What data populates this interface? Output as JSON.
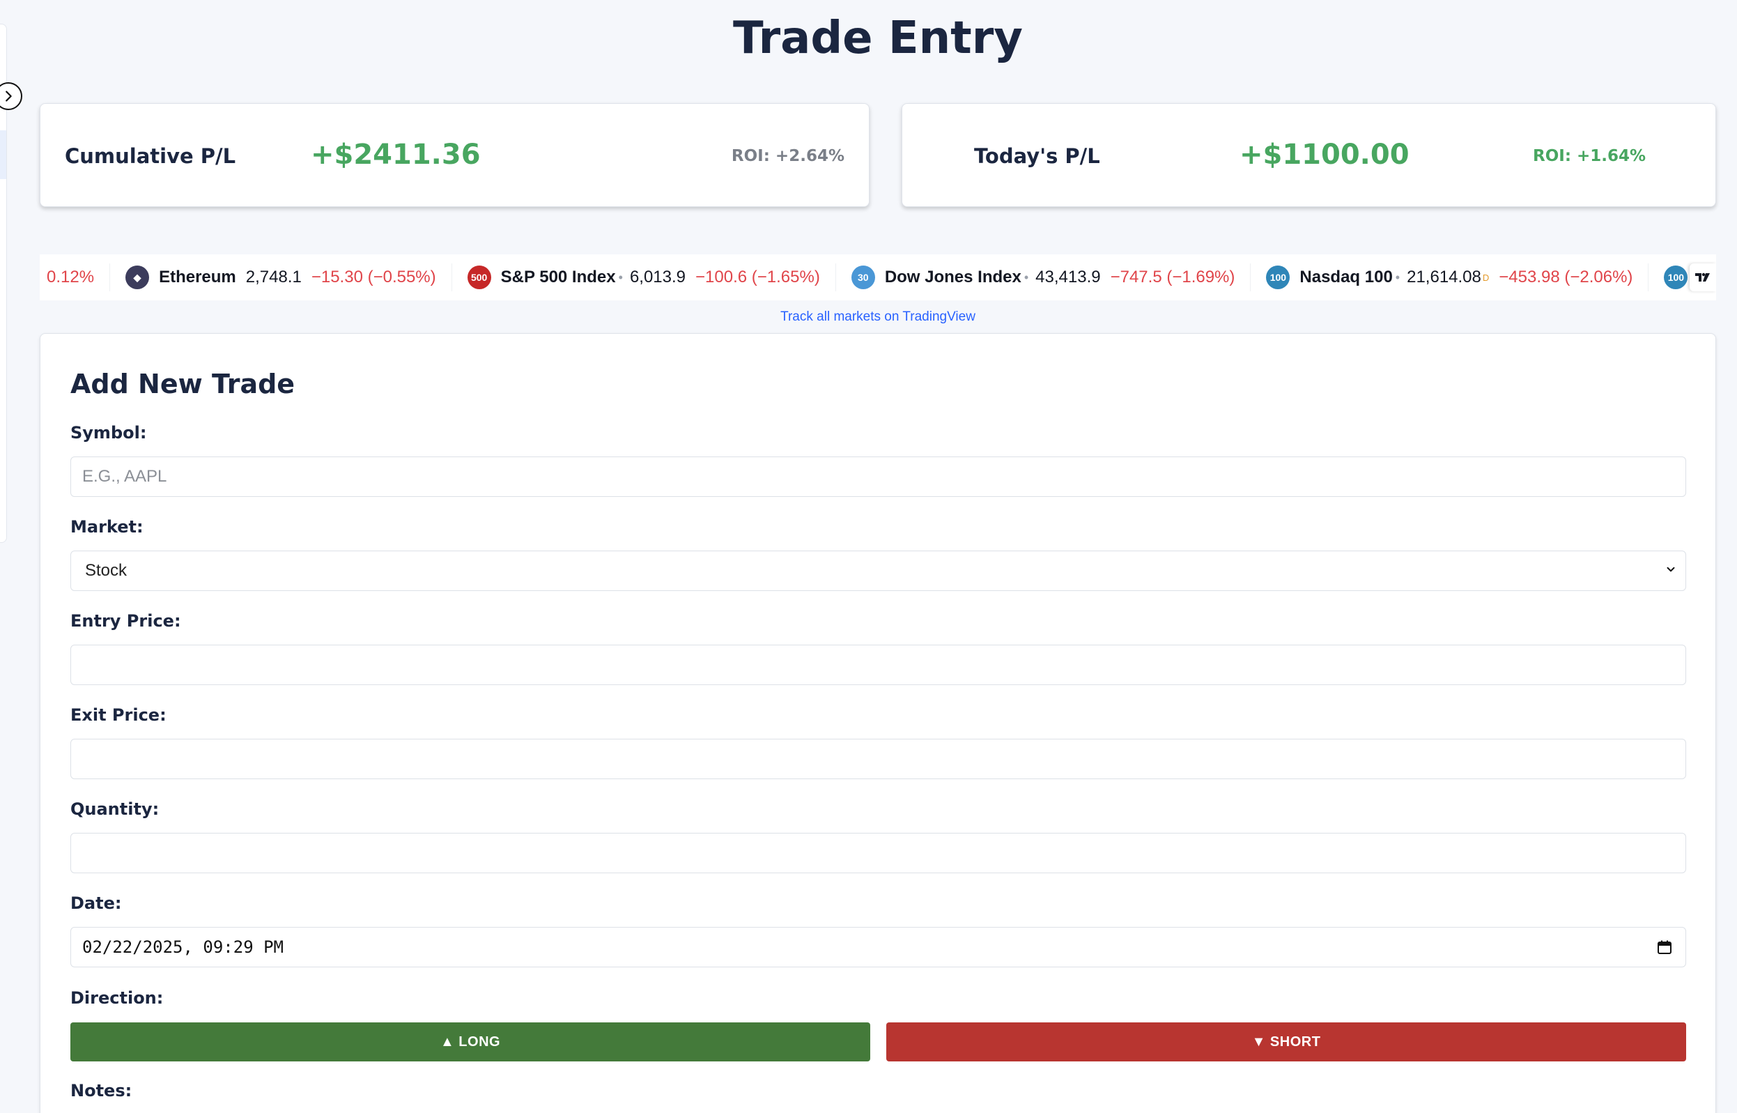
{
  "page": {
    "title": "Trade Entry"
  },
  "cards": {
    "cumulative": {
      "label": "Cumulative P/L",
      "value": "+$2411.36",
      "roi": "ROI: +2.64%"
    },
    "today": {
      "label": "Today's P/L",
      "value": "+$1100.00",
      "roi": "ROI: +1.64%"
    }
  },
  "ticker": {
    "items": [
      {
        "logo": "",
        "logo_color": "#ffffff",
        "name": "",
        "price": "",
        "sup": "",
        "change": "0.12%"
      },
      {
        "logo": "◆",
        "logo_color": "#3c3c5c",
        "name": "Ethereum",
        "price": "2,748.1",
        "sup": "",
        "change": "−15.30 (−0.55%)"
      },
      {
        "logo": "500",
        "logo_color": "#c62828",
        "name": "S&P 500 Index",
        "price": "6,013.9",
        "sup": "",
        "change": "−100.6 (−1.65%)"
      },
      {
        "logo": "30",
        "logo_color": "#4a97d6",
        "name": "Dow Jones Index",
        "price": "43,413.9",
        "sup": "",
        "change": "−747.5 (−1.69%)"
      },
      {
        "logo": "100",
        "logo_color": "#2f86b8",
        "name": "Nasdaq 100",
        "price": "21,614.08",
        "sup": "D",
        "change": "−453.98 (−2.06%)"
      },
      {
        "logo": "100",
        "logo_color": "#2f86b8",
        "name": "",
        "price": "",
        "sup": "",
        "change": ""
      }
    ],
    "badge": "TV",
    "link_text": "Track all markets on TradingView"
  },
  "form": {
    "title": "Add New Trade",
    "symbol": {
      "label": "Symbol:",
      "placeholder": "E.G., AAPL"
    },
    "market": {
      "label": "Market:",
      "value": "Stock"
    },
    "entry_price": {
      "label": "Entry Price:",
      "value": ""
    },
    "exit_price": {
      "label": "Exit Price:",
      "value": ""
    },
    "quantity": {
      "label": "Quantity:",
      "value": ""
    },
    "date": {
      "label": "Date:",
      "value": "02/22/2025, 09:29 PM"
    },
    "direction": {
      "label": "Direction:",
      "long": "▲ LONG",
      "short": "▼ SHORT"
    },
    "notes": {
      "label": "Notes:"
    }
  }
}
